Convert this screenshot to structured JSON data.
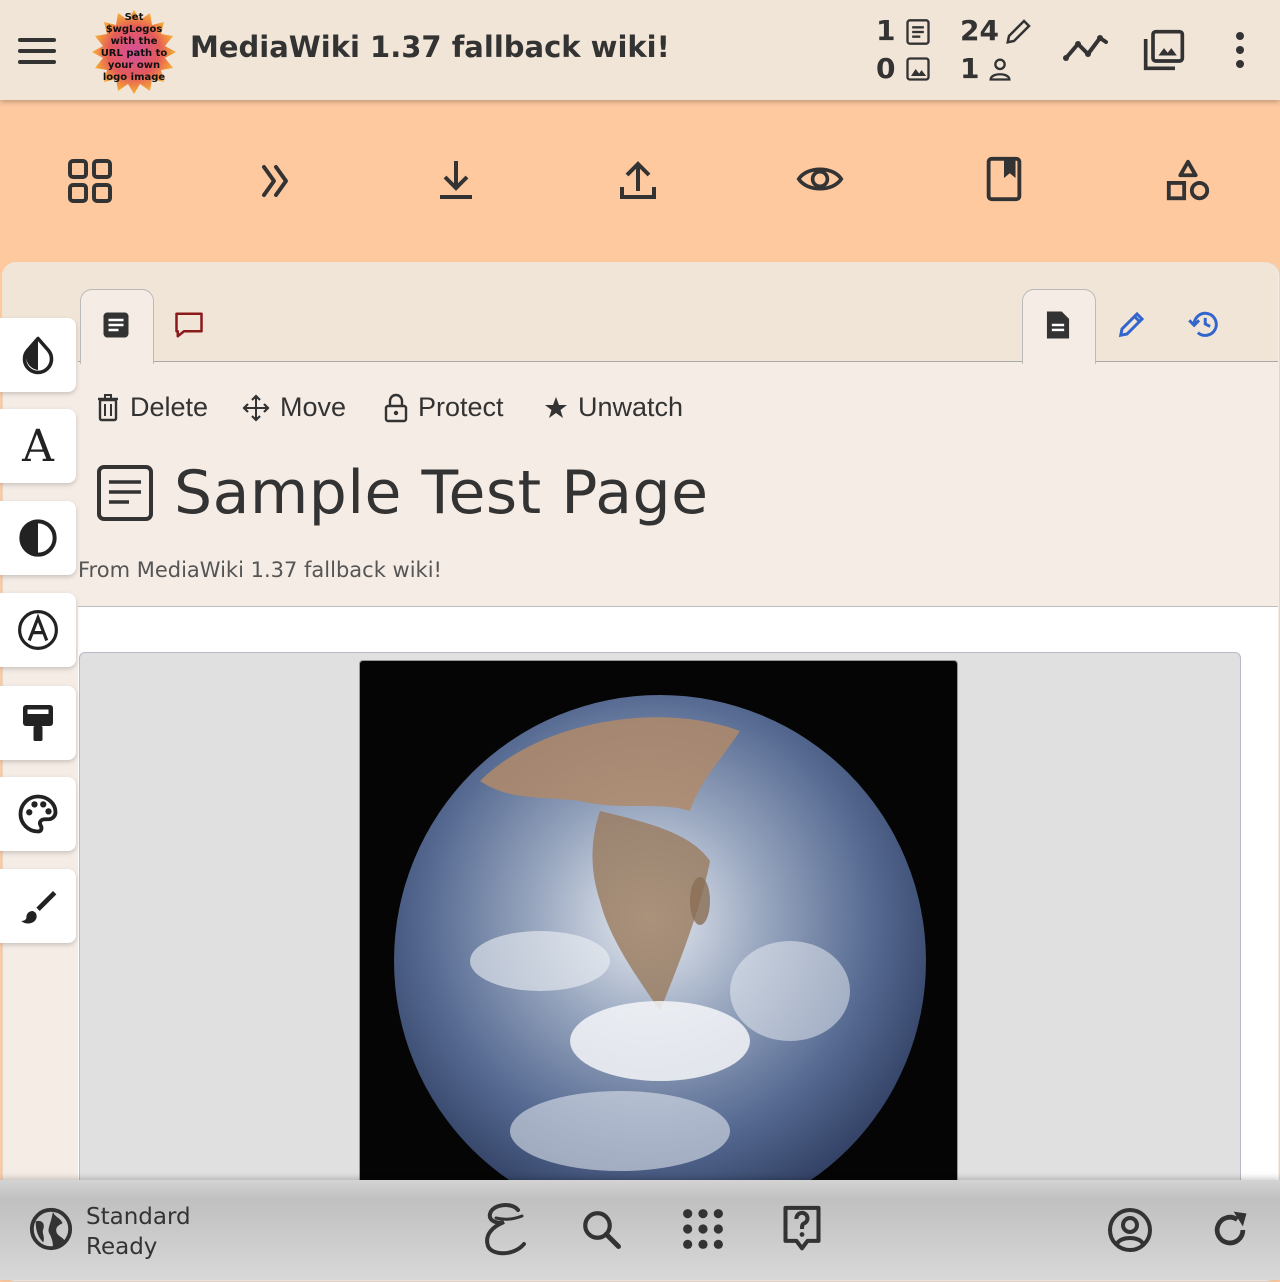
{
  "header": {
    "site_title": "MediaWiki 1.37 fallback wiki!",
    "logo_text": "Set $wgLogos with the URL path to your own logo image",
    "stats": {
      "pages": "1",
      "edits": "24",
      "files": "0",
      "users": "1"
    }
  },
  "tabs": {
    "left": [
      "page-tab",
      "discussion-tab"
    ],
    "right": [
      "read-tab",
      "edit-tab",
      "history-tab"
    ]
  },
  "actions": {
    "delete": "Delete",
    "move": "Move",
    "protect": "Protect",
    "unwatch": "Unwatch"
  },
  "page": {
    "title": "Sample Test Page",
    "subtitle": "From MediaWiki 1.37 fallback wiki!"
  },
  "footer": {
    "status_line1": "Standard",
    "status_line2": "Ready"
  },
  "colors": {
    "header_bg": "#f1e5d8",
    "toolbar_bg": "#ffc9a0",
    "accent_blue": "#3366cc",
    "discussion_red": "#8b1a1a"
  }
}
